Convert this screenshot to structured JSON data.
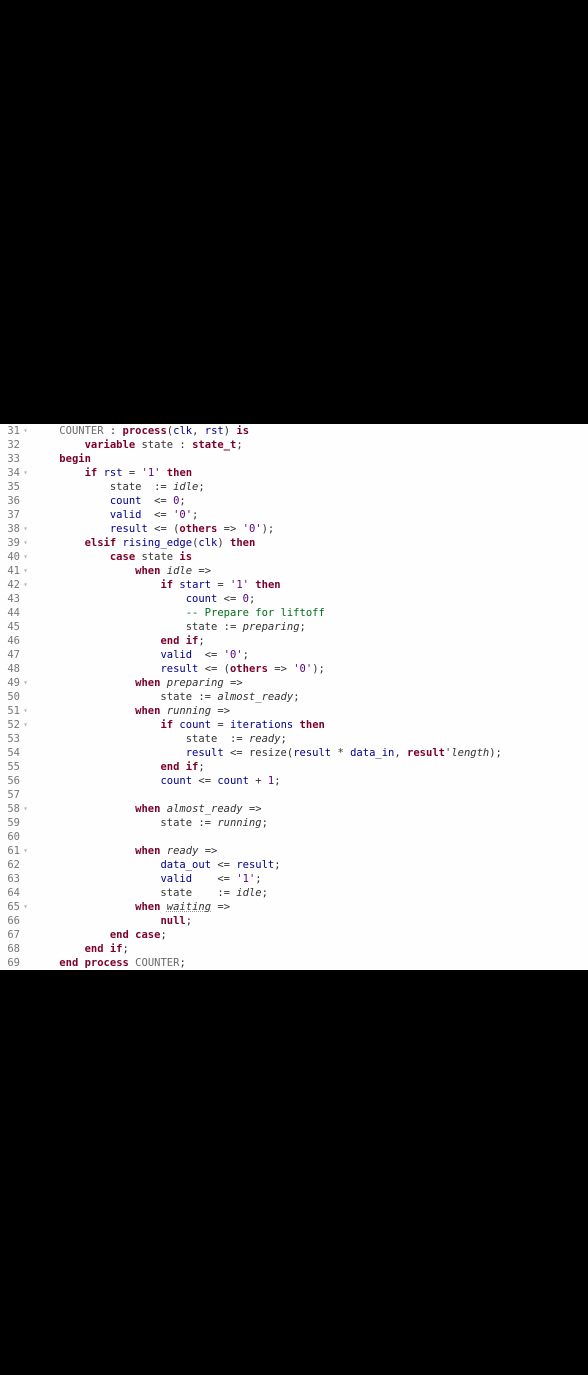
{
  "gutter": {
    "start": 31,
    "end": 69,
    "fold_lines": [
      31,
      34,
      38,
      39,
      40,
      41,
      42,
      49,
      51,
      52,
      58,
      61,
      65
    ]
  },
  "code": {
    "l31": {
      "indent": "    ",
      "label": "COUNTER",
      "kw1": "process",
      "args_open": "(",
      "a1": "clk",
      "comma": ", ",
      "a2": "rst",
      "args_close": ") ",
      "kw2": "is"
    },
    "l32": {
      "indent": "        ",
      "kw": "variable",
      "name": " state : ",
      "type": "state_t",
      "semi": ";"
    },
    "l33": {
      "indent": "    ",
      "kw": "begin"
    },
    "l34": {
      "indent": "        ",
      "kw1": "if",
      "sp": " ",
      "sig": "rst",
      "eq": " = ",
      "lit": "'1'",
      "sp2": " ",
      "kw2": "then"
    },
    "l35": {
      "indent": "            ",
      "t": "state  := ",
      "val": "idle",
      "semi": ";"
    },
    "l36": {
      "indent": "            ",
      "sig": "count",
      "op": "  <= ",
      "lit": "0",
      "semi": ";"
    },
    "l37": {
      "indent": "            ",
      "sig": "valid",
      "op": "  <= ",
      "lit": "'0'",
      "semi": ";"
    },
    "l38": {
      "indent": "            ",
      "sig": "result",
      "op": " <= (",
      "kw": "others",
      "arrow": " => ",
      "lit": "'0'",
      "close": ");"
    },
    "l39": {
      "indent": "        ",
      "kw1": "elsif",
      "sp": " ",
      "fn": "rising_edge",
      "open": "(",
      "sig": "clk",
      "close": ") ",
      "kw2": "then"
    },
    "l40": {
      "indent": "            ",
      "kw1": "case",
      "sp": " ",
      "name": "state ",
      "kw2": "is"
    },
    "l41": {
      "indent": "                ",
      "kw": "when",
      "sp": " ",
      "val": "idle",
      "arrow": " =>"
    },
    "l42": {
      "indent": "                    ",
      "kw1": "if",
      "sp": " ",
      "sig": "start",
      "eq": " = ",
      "lit": "'1'",
      "sp2": " ",
      "kw2": "then"
    },
    "l43": {
      "indent": "                        ",
      "sig": "count",
      "op": " <= ",
      "lit": "0",
      "semi": ";"
    },
    "l44": {
      "indent": "                        ",
      "cmt": "-- Prepare for liftoff"
    },
    "l45": {
      "indent": "                        ",
      "name": "state := ",
      "val": "preparing",
      "semi": ";"
    },
    "l46": {
      "indent": "                    ",
      "kw": "end if",
      "semi": ";"
    },
    "l47": {
      "indent": "                    ",
      "sig": "valid",
      "op": "  <= ",
      "lit": "'0'",
      "semi": ";"
    },
    "l48": {
      "indent": "                    ",
      "sig": "result",
      "op": " <= (",
      "kw": "others",
      "arrow": " => ",
      "lit": "'0'",
      "close": ");"
    },
    "l49": {
      "indent": "                ",
      "kw": "when",
      "sp": " ",
      "val": "preparing",
      "arrow": " =>"
    },
    "l50": {
      "indent": "                    ",
      "name": "state := ",
      "val": "almost_ready",
      "semi": ";"
    },
    "l51": {
      "indent": "                ",
      "kw": "when",
      "sp": " ",
      "val": "running",
      "arrow": " =>"
    },
    "l52": {
      "indent": "                    ",
      "kw1": "if",
      "sp": " ",
      "sig": "count",
      "eq": " = ",
      "sig2": "iterations",
      "sp2": " ",
      "kw2": "then"
    },
    "l53": {
      "indent": "                        ",
      "name": "state  := ",
      "val": "ready",
      "semi": ";"
    },
    "l54": {
      "indent": "                        ",
      "sig": "result",
      "op": " <= ",
      "fn": "resize",
      "open": "(",
      "sig2": "result",
      "mul": " * ",
      "sig3": "data_in",
      "comma": ", ",
      "sig4": "result",
      "tick": "'",
      "attr": "length",
      "close": ");"
    },
    "l55": {
      "indent": "                    ",
      "kw": "end if",
      "semi": ";"
    },
    "l56": {
      "indent": "                    ",
      "sig": "count",
      "op": " <= ",
      "sig2": "count",
      "plus": " + ",
      "lit": "1",
      "semi": ";"
    },
    "l57": {
      "indent": ""
    },
    "l58": {
      "indent": "                ",
      "kw": "when",
      "sp": " ",
      "val": "almost_ready",
      "arrow": " =>"
    },
    "l59": {
      "indent": "                    ",
      "name": "state := ",
      "val": "running",
      "semi": ";"
    },
    "l60": {
      "indent": ""
    },
    "l61": {
      "indent": "                ",
      "kw": "when",
      "sp": " ",
      "val": "ready",
      "arrow": " =>"
    },
    "l62": {
      "indent": "                    ",
      "sig": "data_out",
      "op": " <= ",
      "sig2": "result",
      "semi": ";"
    },
    "l63": {
      "indent": "                    ",
      "sig": "valid",
      "op": "    <= ",
      "lit": "'1'",
      "semi": ";"
    },
    "l64": {
      "indent": "                    ",
      "name": "state    := ",
      "val": "idle",
      "semi": ";"
    },
    "l65": {
      "indent": "                ",
      "kw": "when",
      "sp": " ",
      "val": "waiting",
      "arrow": " =>"
    },
    "l66": {
      "indent": "                    ",
      "kw": "null",
      "semi": ";"
    },
    "l67": {
      "indent": "            ",
      "kw": "end case",
      "semi": ";"
    },
    "l68": {
      "indent": "        ",
      "kw": "end if",
      "semi": ";"
    },
    "l69": {
      "indent": "    ",
      "kw": "end process",
      "sp": " ",
      "label": "COUNTER",
      "semi": ";"
    }
  }
}
